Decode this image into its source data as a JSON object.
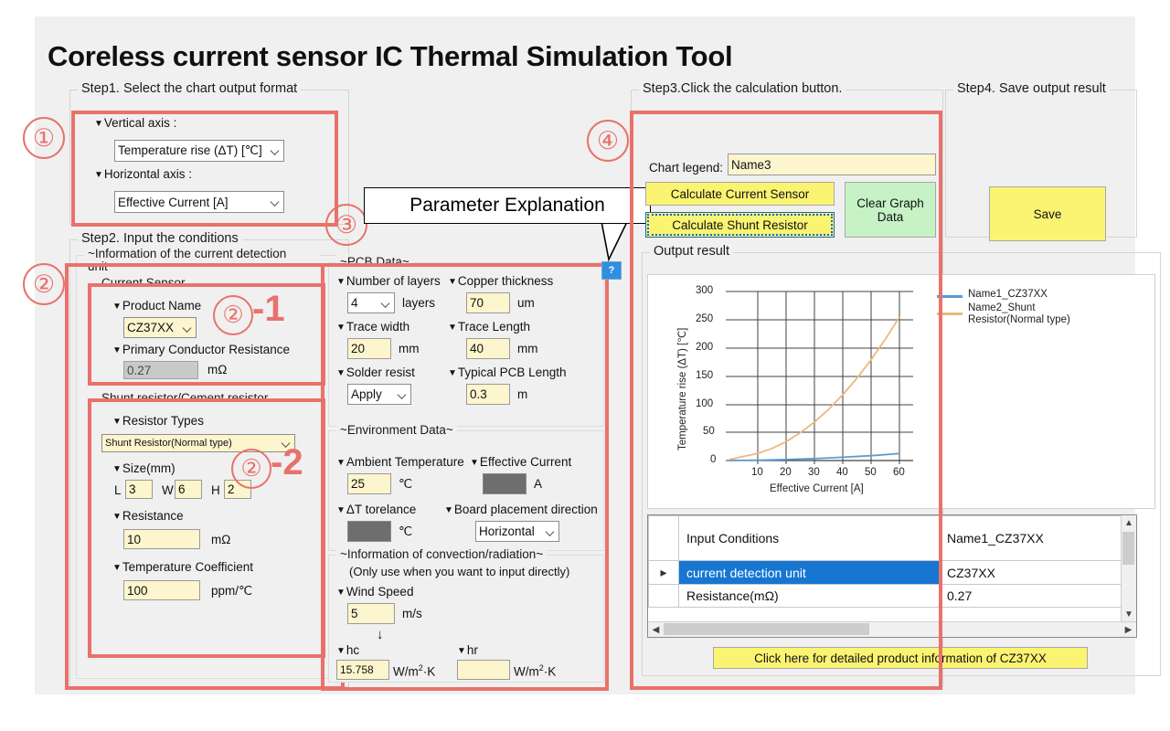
{
  "app": {
    "title": "Coreless current sensor IC Thermal Simulation Tool"
  },
  "annotations": {
    "marker1": "①",
    "marker2": "②",
    "marker3": "③",
    "marker4": "④",
    "marker2_1_circle": "②",
    "marker2_1_suffix": "-1",
    "marker2_2_circle": "②",
    "marker2_2_suffix": "-2",
    "callout": "Parameter Explanation",
    "help_button": "?"
  },
  "step1": {
    "caption": "Step1. Select the chart output format",
    "vertical_axis_label": "Vertical axis :",
    "vertical_axis_value": "Temperature rise (ΔT) [℃]",
    "horizontal_axis_label": "Horizontal axis :",
    "horizontal_axis_value": "Effective Current [A]"
  },
  "step2": {
    "caption": "Step2. Input the conditions",
    "detection_unit_caption": "~Information of the current detection unit~",
    "current_sensor": {
      "caption": "Current Sensor",
      "product_name_label": "Product Name",
      "product_name_value": "CZ37XX",
      "primary_resistance_label": "Primary Conductor Resistance",
      "primary_resistance_value": "0.27",
      "primary_resistance_unit": "mΩ"
    },
    "shunt": {
      "caption": "Shunt resistor/Cement resistor",
      "resistor_types_label": "Resistor Types",
      "resistor_types_value": "Shunt Resistor(Normal type)",
      "size_label": "Size(mm)",
      "size_l_label": "L",
      "size_l_value": "3",
      "size_w_label": "W",
      "size_w_value": "6",
      "size_h_label": "H",
      "size_h_value": "2",
      "resistance_label": "Resistance",
      "resistance_value": "10",
      "resistance_unit": "mΩ",
      "tempco_label": "Temperature Coefficient",
      "tempco_value": "100",
      "tempco_unit": "ppm/℃"
    },
    "pcb": {
      "caption": "~PCB Data~",
      "layers_label": "Number of layers",
      "layers_value": "4",
      "layers_unit": "layers",
      "copper_label": "Copper thickness",
      "copper_value": "70",
      "copper_unit": "um",
      "trace_width_label": "Trace width",
      "trace_width_value": "20",
      "trace_width_unit": "mm",
      "trace_length_label": "Trace Length",
      "trace_length_value": "40",
      "trace_length_unit": "mm",
      "solder_label": "Solder resist",
      "solder_value": "Apply",
      "pcb_length_label": "Typical PCB Length",
      "pcb_length_value": "0.3",
      "pcb_length_unit": "m"
    },
    "environment": {
      "caption": "~Environment Data~",
      "ambient_label": "Ambient Temperature",
      "ambient_value": "25",
      "ambient_unit": "℃",
      "effective_current_label": "Effective Current",
      "effective_current_value": "",
      "effective_current_unit": "A",
      "dt_tolerance_label": "ΔT torelance",
      "dt_tolerance_value": "",
      "dt_tolerance_unit": "℃",
      "board_direction_label": "Board placement direction",
      "board_direction_value": "Horizontal"
    },
    "convection": {
      "caption": "~Information of convection/radiation~",
      "note": "(Only use when you want to input directly)",
      "wind_label": "Wind Speed",
      "wind_value": "5",
      "wind_unit": "m/s",
      "arrow": "↓",
      "hc_label": "hc",
      "hc_value": "15.758",
      "hc_unit": "W/m",
      "hc_unit_sup": "2",
      "hc_unit_tail": "·K",
      "hr_label": "hr",
      "hr_value": "",
      "hr_unit": "W/m",
      "hr_unit_sup": "2",
      "hr_unit_tail": "·K"
    }
  },
  "step3": {
    "caption": "Step3.Click the calculation button.",
    "legend_label": "Chart legend:",
    "legend_value": "Name3",
    "calc_sensor_button": "Calculate Current Sensor",
    "calc_shunt_button": "Calculate Shunt Resistor",
    "clear_button": "Clear Graph Data",
    "output_caption": "Output result",
    "detail_link": "Click here for detailed product information of CZ37XX"
  },
  "step4": {
    "caption": "Step4. Save output result",
    "save_button": "Save"
  },
  "colors": {
    "accent_red": "#e8726b",
    "yellow_field": "#fcf5cd",
    "yellow_button": "#faf472",
    "green_button": "#c6f2c6",
    "series1": "#5b9bd5",
    "series2": "#edb87c",
    "selection_blue": "#1676d2"
  },
  "chart_data": {
    "type": "line",
    "title": "",
    "xlabel": "Effective Current [A]",
    "ylabel": "Temperature rise (ΔT) [℃]",
    "xlim": [
      5,
      65
    ],
    "ylim": [
      0,
      300
    ],
    "xticks": [
      10,
      20,
      30,
      40,
      50,
      60
    ],
    "yticks": [
      0,
      50,
      100,
      150,
      200,
      250,
      300
    ],
    "grid": true,
    "legend_position": "right",
    "x": [
      5,
      10,
      15,
      20,
      25,
      30,
      35,
      40,
      45,
      50,
      55,
      60
    ],
    "series": [
      {
        "name": "Name1_CZ37XX",
        "color": "#5b9bd5",
        "values": [
          0.1,
          0.4,
          0.9,
          1.6,
          2.5,
          3.6,
          4.9,
          6.4,
          8.1,
          10.0,
          12.0,
          14.2
        ]
      },
      {
        "name": "Name2_Shunt Resistor(Normal type)",
        "color": "#edb87c",
        "values": [
          1.8,
          7.3,
          16.5,
          29.3,
          45.8,
          66.0,
          89.8,
          117.3,
          148.4,
          183.3,
          221.8,
          264.0
        ]
      }
    ]
  },
  "output_table": {
    "headers": [
      "",
      "Input Conditions",
      "Name1_CZ37XX"
    ],
    "rows": [
      {
        "marker": "▸",
        "label": "current detection unit",
        "value": "CZ37XX",
        "selected": true
      },
      {
        "marker": "",
        "label": "Resistance(mΩ)",
        "value": "0.27",
        "selected": false
      }
    ]
  }
}
